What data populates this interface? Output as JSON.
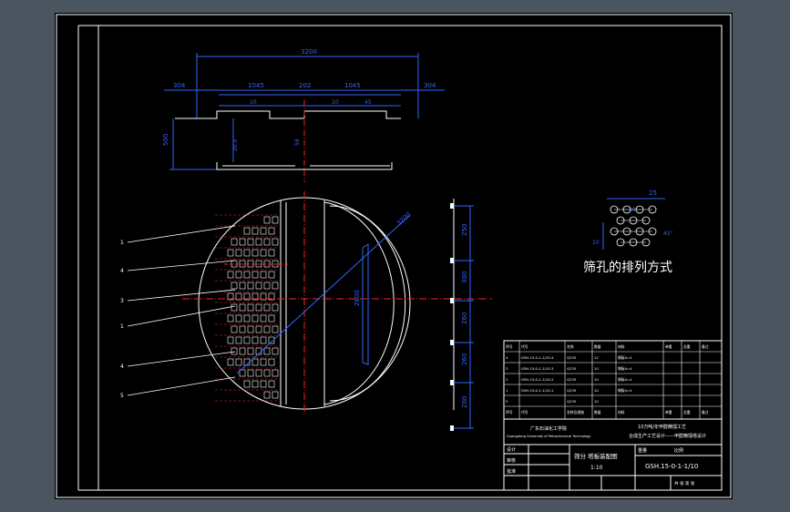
{
  "colors": {
    "background": "#4a5560",
    "paper": "#000000",
    "linework": "#ffffff",
    "dimension": "#2f66ff",
    "centerline": "#ff2020"
  },
  "top_view_dims": {
    "overall": "3200",
    "left_end": "304",
    "left_span": "1045",
    "center": "202",
    "right_span": "1045",
    "right_end": "304",
    "small_a": "10",
    "small_b": "10",
    "small_c": "45",
    "height": "500",
    "depth": "20.5",
    "mid": "58"
  },
  "plate_dims": {
    "diameter": "3200",
    "inner": "2800",
    "right_stack": [
      "250",
      "300",
      "260",
      "260",
      "200"
    ]
  },
  "callout_numbers": [
    "1",
    "4",
    "3",
    "1",
    "4",
    "5"
  ],
  "hole_pattern": {
    "caption": "筛孔的排列方式",
    "dim_pitch": "25",
    "dim_hole": "10",
    "dim_row": "10",
    "dim_angle": "45°"
  },
  "bom": {
    "header": [
      "序号",
      "代号",
      "名称",
      "数量",
      "材料",
      "单重",
      "总重",
      "备注"
    ],
    "rows": [
      [
        "4",
        "GSH.15-0-1-1/10-4",
        "Q235",
        "12",
        "钢板δ=4",
        "",
        "",
        ""
      ],
      [
        "3",
        "GSH.15-0-1-1/10-3",
        "Q235",
        "10",
        "钢板δ=4",
        "",
        "",
        ""
      ],
      [
        "2",
        "GSH.15-0-1-1/10-2",
        "Q235",
        "10",
        "钢板δ=4",
        "",
        "",
        ""
      ],
      [
        "1",
        "GSH.15-0-1-1/10-1",
        "Q235",
        "10",
        "钢板δ=4",
        "",
        "",
        ""
      ],
      [
        "5",
        "",
        "Q235",
        "10",
        "",
        "",
        "",
        ""
      ]
    ],
    "footer": [
      "序号",
      "代号",
      "名称及规格",
      "数量",
      "材料",
      "单重",
      "总重",
      "备注"
    ]
  },
  "title_block": {
    "school": "广东石油化工学院",
    "school_en": "Guangdong University of Petrochemical Technology",
    "project": "10万吨/年甲醇精馏工艺",
    "project2": "合成生产工艺设计——甲醇精馏塔设计",
    "drawing_name": "筛分 塔板装配图",
    "scale": "1:10",
    "drawing_no": "GSH.15-0-1-1/10",
    "role_design": "设计",
    "role_check": "审核",
    "role_approve": "批准",
    "sheet_info": "共 张 第 张",
    "weight": "重量",
    "ratio": "比例"
  }
}
